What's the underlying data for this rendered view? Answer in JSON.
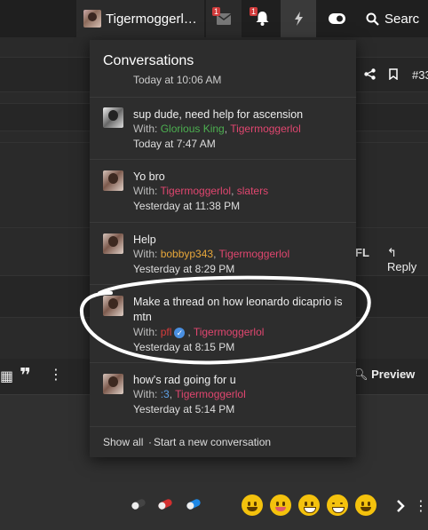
{
  "navbar": {
    "username": "Tigermoggerl…",
    "inbox_badge": "1",
    "alerts_badge": "1",
    "search_label": "Searc"
  },
  "background": {
    "thread_number": "#33",
    "fl_label": "FL",
    "reply_label": "Reply",
    "preview_label": "Preview"
  },
  "dropdown": {
    "title": "Conversations",
    "partial_time": "Today at 10:06 AM",
    "conversations": [
      {
        "title": "sup dude, need help for ascension",
        "with_label": "With:",
        "participants": [
          "Glorious King",
          "Tigermoggerlol"
        ],
        "time": "Today at 7:47 AM"
      },
      {
        "title": "Yo bro",
        "with_label": "With:",
        "participants": [
          "Tigermoggerlol",
          "slaters"
        ],
        "time": "Yesterday at 11:38 PM"
      },
      {
        "title": "Help",
        "with_label": "With:",
        "participants": [
          "bobbyp343",
          "Tigermoggerlol"
        ],
        "time": "Yesterday at 8:29 PM"
      },
      {
        "title": "Make a thread on how leonardo dicaprio is mtn",
        "with_label": "With:",
        "participants": [
          "pfl",
          "Tigermoggerlol"
        ],
        "time": "Yesterday at 8:15 PM"
      },
      {
        "title": "how's rad going for u",
        "with_label": "With:",
        "participants": [
          ":3",
          "Tigermoggerlol"
        ],
        "time": "Yesterday at 5:14 PM"
      }
    ],
    "footer": {
      "show_all": "Show all",
      "separator": "·",
      "start_new": "Start a new conversation"
    }
  },
  "colors": {
    "accent_pink": "#e0466f",
    "green_user": "#4caf50",
    "orange_user": "#e6a63a",
    "badge_red": "#d03b3b"
  }
}
